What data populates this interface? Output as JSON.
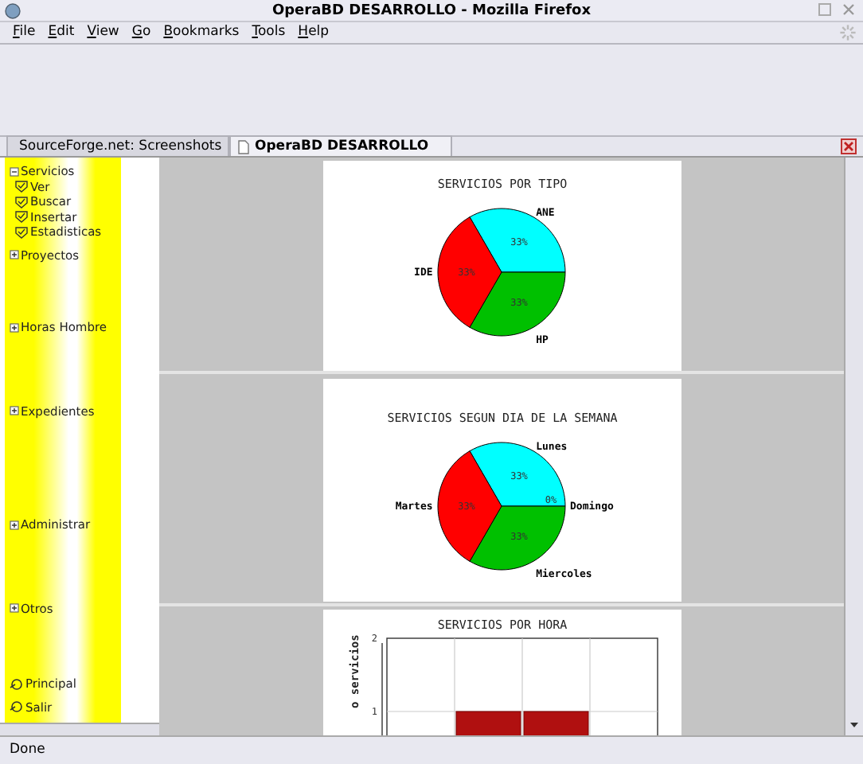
{
  "window": {
    "title": "OperaBD DESARROLLO - Mozilla Firefox"
  },
  "menu": [
    "File",
    "Edit",
    "View",
    "Go",
    "Bookmarks",
    "Tools",
    "Help"
  ],
  "tabs": [
    {
      "label": "SourceForge.net: Screenshots",
      "selected": false
    },
    {
      "label": "OperaBD DESARROLLO",
      "selected": true
    }
  ],
  "sidebar": {
    "items": [
      {
        "label": "Servicios",
        "kind": "folder",
        "expanded": true,
        "children": [
          {
            "label": "Ver",
            "kind": "action"
          },
          {
            "label": "Buscar",
            "kind": "action"
          },
          {
            "label": "Insertar",
            "kind": "action"
          },
          {
            "label": "Estadisticas",
            "kind": "action"
          }
        ]
      },
      {
        "label": "Proyectos",
        "kind": "folder",
        "expanded": false
      },
      {
        "label": "Horas Hombre",
        "kind": "folder",
        "expanded": false
      },
      {
        "label": "Expedientes",
        "kind": "folder",
        "expanded": false
      },
      {
        "label": "Administrar",
        "kind": "folder",
        "expanded": false
      },
      {
        "label": "Otros",
        "kind": "folder",
        "expanded": false
      },
      {
        "label": "Principal",
        "kind": "link"
      },
      {
        "label": "Salir",
        "kind": "link"
      }
    ]
  },
  "charts": [
    {
      "chart_data": {
        "type": "pie",
        "title": "SERVICIOS POR TIPO",
        "categories": [
          "ANE",
          "HP",
          "IDE"
        ],
        "values": [
          33,
          33,
          33
        ],
        "value_labels": [
          "33%",
          "33%",
          "33%"
        ],
        "colors": [
          "#00ffff",
          "#00c000",
          "#ff0000"
        ]
      }
    },
    {
      "chart_data": {
        "type": "pie",
        "title": "SERVICIOS SEGUN DIA DE LA SEMANA",
        "categories": [
          "Lunes",
          "Domingo",
          "Miercoles",
          "Martes"
        ],
        "values": [
          33,
          0,
          33,
          33
        ],
        "value_labels": [
          "33%",
          "0%",
          "33%",
          "33%"
        ],
        "colors": [
          "#00ffff",
          null,
          "#00c000",
          "#ff0000"
        ]
      }
    },
    {
      "chart_data": {
        "type": "bar",
        "title": "SERVICIOS POR HORA",
        "ylabel": "o servicios",
        "ylim": [
          0,
          2
        ],
        "yticks": [
          1,
          2
        ],
        "values": [
          null,
          1,
          1,
          null
        ]
      }
    }
  ],
  "status_bar": {
    "text": "Done"
  }
}
